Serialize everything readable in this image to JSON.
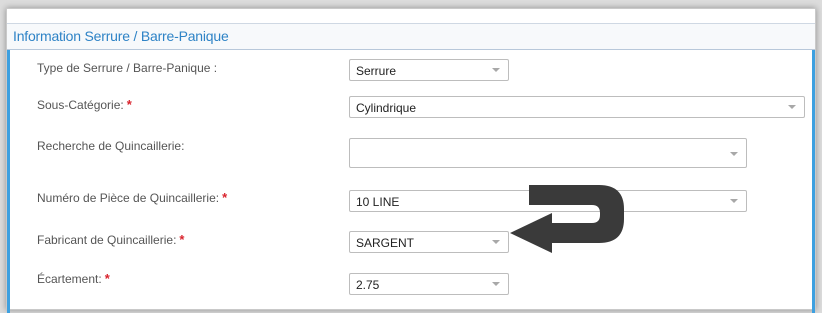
{
  "panel": {
    "title": "Information Serrure / Barre-Panique"
  },
  "required_mark": "*",
  "fields": [
    {
      "label": "Type de Serrure / Barre-Panique :",
      "required": false,
      "value": "Serrure"
    },
    {
      "label": "Sous-Catégorie:",
      "required": true,
      "value": "Cylindrique"
    },
    {
      "label": "Recherche de Quincaillerie:",
      "required": false,
      "value": ""
    },
    {
      "label": "Numéro de Pièce de Quincaillerie:",
      "required": true,
      "value": "10 LINE"
    },
    {
      "label": "Fabricant de Quincaillerie:",
      "required": true,
      "value": "SARGENT"
    },
    {
      "label": "Écartement:",
      "required": true,
      "value": "2.75"
    }
  ],
  "annotation": {
    "icon": "u-turn-arrow-icon",
    "color": "#3a3a3a"
  },
  "colors": {
    "accent": "#2e83c6",
    "required": "#d9232d",
    "border": "#3da0e0"
  }
}
